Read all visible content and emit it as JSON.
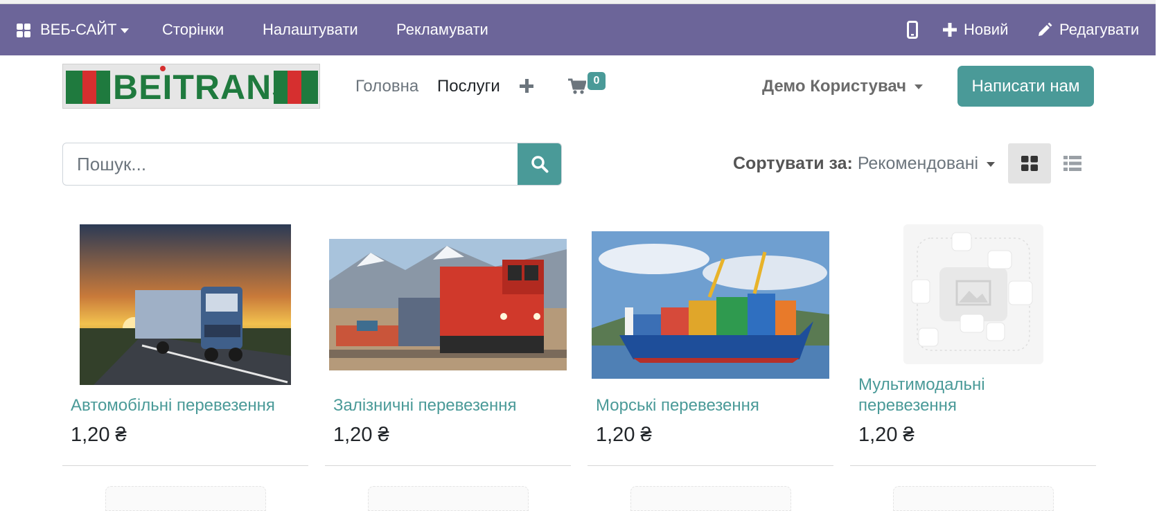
{
  "admin_bar": {
    "apps_label": "ВЕБ-САЙТ",
    "pages": "Сторінки",
    "customize": "Налаштувати",
    "promote": "Рекламувати",
    "new": "Новий",
    "edit": "Редагувати",
    "icons": [
      "apps-grid-icon",
      "mobile-icon",
      "plus-icon",
      "pencil-icon"
    ]
  },
  "header": {
    "logo_text": "BEITRANS",
    "nav": [
      "Головна",
      "Послуги"
    ],
    "cart_count": "0",
    "user_name": "Демо Користувач",
    "contact_button": "Написати нам"
  },
  "search": {
    "placeholder": "Пошук..."
  },
  "sort": {
    "label": "Сортувати за:",
    "value": "Рекомендовані"
  },
  "products": [
    {
      "title": "Автомобільні перевезення",
      "price": "1,20 ₴"
    },
    {
      "title": "Залізничні перевезення",
      "price": "1,20 ₴"
    },
    {
      "title": "Морські перевезення",
      "price": "1,20 ₴"
    },
    {
      "title": "Мультимодальні перевезення",
      "price": "1,20 ₴"
    }
  ],
  "colors": {
    "admin_bar": "#6c6599",
    "accent": "#4a9a98",
    "logo_green": "#1f7a3e",
    "logo_red": "#d62f2f"
  }
}
